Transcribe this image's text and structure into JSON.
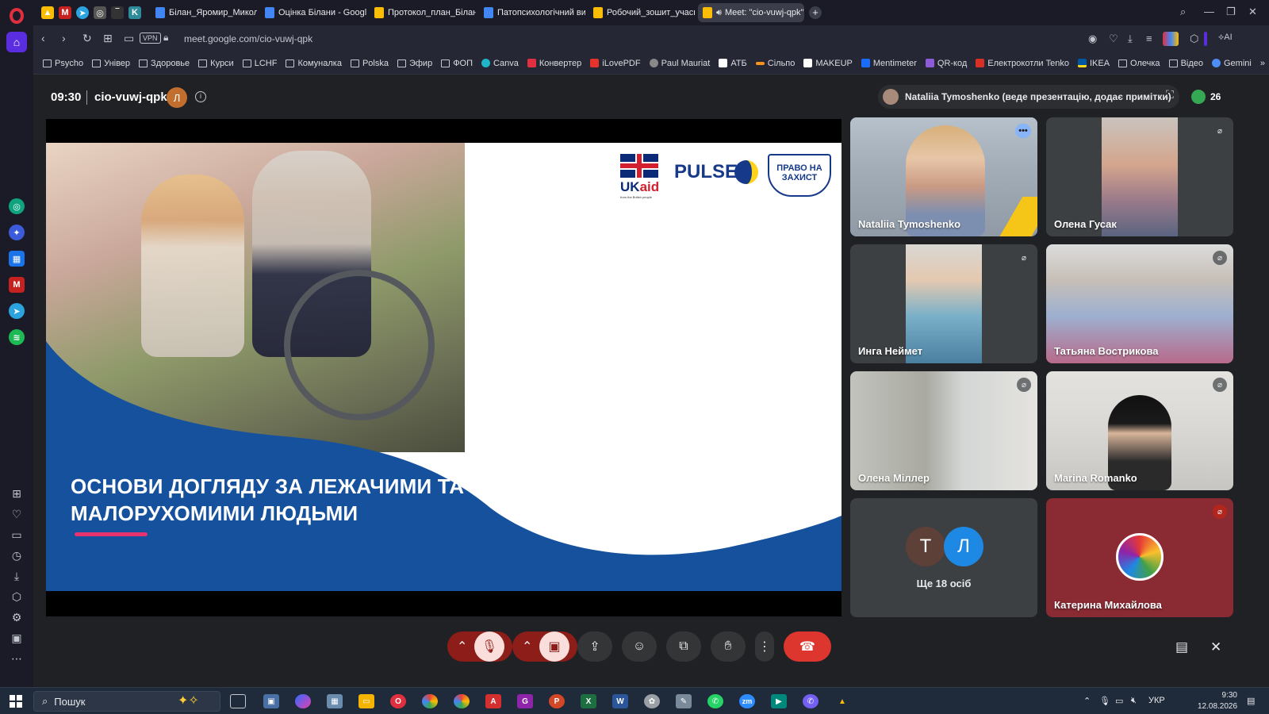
{
  "browser": {
    "tabs": [
      {
        "label": "Білан_Яромир_Миколаїв"
      },
      {
        "label": "Оцінка Білани - Google Д"
      },
      {
        "label": "Протокол_план_Білан_Яр"
      },
      {
        "label": "Патопсихологічний висн"
      },
      {
        "label": "Робочий_зошит_учасник"
      },
      {
        "label": "Meet: \"cio-vuwj-qpk\""
      }
    ],
    "new_tab": "+",
    "url": "meet.google.com/cio-vuwj-qpk",
    "vpn_label": "VPN",
    "ai_label": "AI",
    "bookmarks": [
      {
        "label": "Psycho"
      },
      {
        "label": "Універ"
      },
      {
        "label": "Здоровье"
      },
      {
        "label": "Курси"
      },
      {
        "label": "LCHF"
      },
      {
        "label": "Комуналка"
      },
      {
        "label": "Polska"
      },
      {
        "label": "Эфир"
      },
      {
        "label": "ФОП"
      },
      {
        "label": "Canva"
      },
      {
        "label": "Конвертер"
      },
      {
        "label": "iLovePDF"
      },
      {
        "label": "Paul Mauriat"
      },
      {
        "label": "АТБ"
      },
      {
        "label": "Сільпо"
      },
      {
        "label": "MAKEUP"
      },
      {
        "label": "Mentimeter"
      },
      {
        "label": "QR-код"
      },
      {
        "label": "Електрокотли Tenko"
      },
      {
        "label": "IKEA"
      },
      {
        "label": "Олечка"
      },
      {
        "label": "Відео"
      },
      {
        "label": "Gemini"
      }
    ]
  },
  "meet": {
    "time": "09:30",
    "meeting_code": "cio-vuwj-qpk",
    "host_initial": "Л",
    "presenter_text": "Nataliia Tymoshenko (веде презентацію, додає примітки)",
    "people_count": "26",
    "slide": {
      "title_line1": "ОСНОВИ ДОГЛЯДУ ЗА ЛЕЖАЧИМИ ТА",
      "title_line2": "МАЛОРУХОМИМИ ЛЮДЬМИ",
      "logo_uk_main": "UK",
      "logo_uk_accent": "aid",
      "logo_uk_sub": "from the British people",
      "logo_pulse": "PULSE",
      "logo_pravo_line1": "ПРАВО НА",
      "logo_pravo_line2": "ЗАХИСТ"
    },
    "participants": [
      {
        "name": "Nataliia Tymoshenko"
      },
      {
        "name": "Олена Гусак"
      },
      {
        "name": "Инга Неймет"
      },
      {
        "name": "Татьяна Вострикова"
      },
      {
        "name": "Олена Міллер"
      },
      {
        "name": "Marina Romanko"
      },
      {
        "name": "Катерина Михайлова"
      }
    ],
    "more_tile": {
      "initial1": "Т",
      "initial2": "Л",
      "label": "Ще 18 осіб"
    }
  },
  "taskbar": {
    "search_placeholder": "Пошук",
    "language": "УКР",
    "clock_time": "9:30",
    "clock_date": "12.08.2026"
  },
  "colors": {
    "meet_bg": "#202124",
    "slide_blue": "#16519e",
    "accent_pink": "#e6336f",
    "end_call": "#dc362e"
  }
}
